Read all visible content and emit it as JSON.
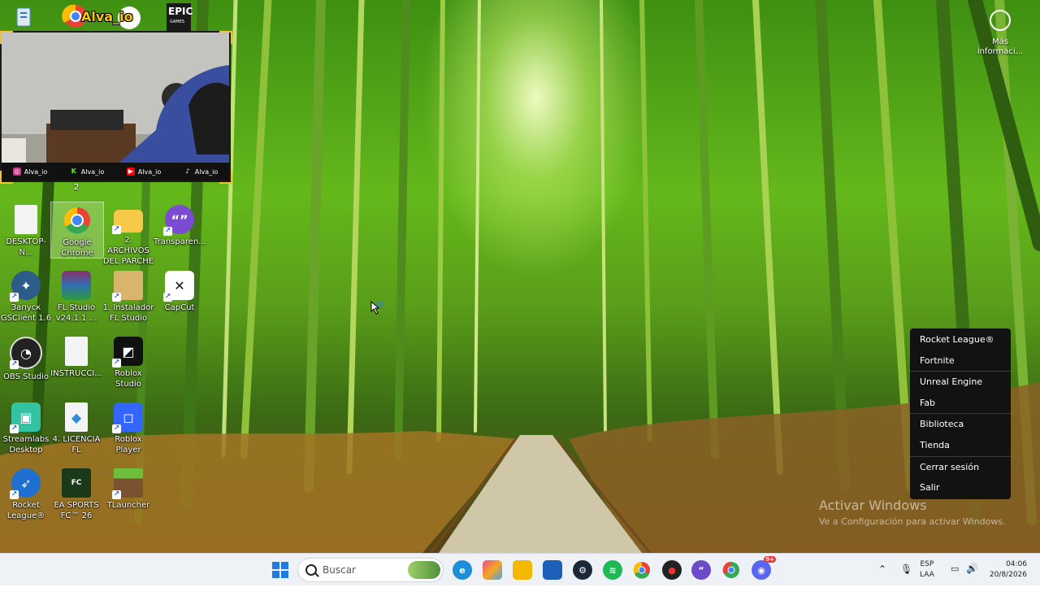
{
  "overlay": {
    "channel_name": "Alva_io",
    "socials": [
      {
        "icon": "instagram-icon",
        "label": "Alva_io",
        "color": "#c13584"
      },
      {
        "icon": "kick-icon",
        "label": "Alva_io",
        "color": "#53fc18"
      },
      {
        "icon": "youtube-icon",
        "label": "Alva_io",
        "color": "#ff0000"
      },
      {
        "icon": "tiktok-icon",
        "label": "Alva_io",
        "color": "#ffffff"
      }
    ],
    "step_number": "2",
    "epic_logo_text": "EPIC",
    "epic_logo_sub": "GAMES"
  },
  "desktop_icons": [
    {
      "name": "desktop-ini",
      "label": "DESKTOP-N...",
      "icon": "document-icon",
      "color": "#f4f4f4"
    },
    {
      "name": "google-chrome",
      "label": "Google Chrome",
      "icon": "chrome-icon",
      "color": "#34a853",
      "selected": true
    },
    {
      "name": "archivos-del-parche",
      "label": "2. ARCHIVOS DEL PARCHE",
      "icon": "folder-icon",
      "color": "#f7c948"
    },
    {
      "name": "transparent",
      "label": "Transparen...",
      "icon": "chat-bubble-icon",
      "color": "#7b4bd1"
    },
    {
      "name": "gsclient",
      "label": "Запуск GSClient 1.6",
      "icon": "counter-strike-icon",
      "color": "#2b5c8a"
    },
    {
      "name": "fl-studio",
      "label": "FL Studio v24.1.1 ...",
      "icon": "winrar-icon",
      "color": "#8e2f6b"
    },
    {
      "name": "instalador-fl",
      "label": "1. Instalador FL Studio",
      "icon": "installer-icon",
      "color": "#d8b56a"
    },
    {
      "name": "capcut",
      "label": "CapCut",
      "icon": "capcut-icon",
      "color": "#ffffff"
    },
    {
      "name": "obs-studio",
      "label": "OBS Studio",
      "icon": "obs-icon",
      "color": "#222222"
    },
    {
      "name": "instrucciones",
      "label": "INSTRUCCI...",
      "icon": "document-icon",
      "color": "#f4f4f4"
    },
    {
      "name": "roblox-studio",
      "label": "Roblox Studio",
      "icon": "roblox-studio-icon",
      "color": "#111111"
    },
    {
      "name": "streamlabs",
      "label": "Streamlabs Desktop",
      "icon": "streamlabs-icon",
      "color": "#31c3a2"
    },
    {
      "name": "licencia-fl",
      "label": "4. LICENCIA FL",
      "icon": "license-icon",
      "color": "#2f8fd6"
    },
    {
      "name": "roblox-player",
      "label": "Roblox Player",
      "icon": "roblox-icon",
      "color": "#3366ff"
    },
    {
      "name": "rocket-league",
      "label": "Rocket League®",
      "icon": "rocket-league-icon",
      "color": "#1f6fd0"
    },
    {
      "name": "ea-fc-26",
      "label": "EA SPORTS FC™ 26",
      "icon": "ea-fc-icon",
      "color": "#1a3a1a"
    },
    {
      "name": "tlauncher",
      "label": "TLauncher",
      "icon": "minecraft-block-icon",
      "color": "#5c8a2e"
    }
  ],
  "more_info": {
    "label": "Más informaci..."
  },
  "tray_menu": {
    "groups": [
      [
        "Rocket League®",
        "Fortnite"
      ],
      [
        "Unreal Engine",
        "Fab"
      ],
      [
        "Biblioteca",
        "Tienda"
      ],
      [
        "Cerrar sesión",
        "Salir"
      ]
    ]
  },
  "watermark": {
    "title": "Activar Windows",
    "subtitle": "Ve a Configuración para activar Windows."
  },
  "taskbar": {
    "search_placeholder": "Buscar",
    "apps": [
      {
        "name": "windows-start",
        "icon": "windows-logo-icon",
        "color": "#1e7be0"
      },
      {
        "name": "widgets",
        "icon": "widgets-landscape-icon",
        "color": "#6aa84f"
      },
      {
        "name": "edge",
        "icon": "edge-icon",
        "color": "#1d8fd8"
      },
      {
        "name": "ms-store",
        "icon": "store-icon",
        "color": "#e44d8e"
      },
      {
        "name": "file-explorer",
        "icon": "folder-icon",
        "color": "#f5b800"
      },
      {
        "name": "app-calculator",
        "icon": "app-icon",
        "color": "#1c5fb8"
      },
      {
        "name": "steam",
        "icon": "steam-icon",
        "color": "#1b2838"
      },
      {
        "name": "spotify",
        "icon": "spotify-icon",
        "color": "#1db954"
      },
      {
        "name": "chrome",
        "icon": "chrome-icon",
        "color": "#ea4335"
      },
      {
        "name": "recorder",
        "icon": "record-icon",
        "color": "#222222"
      },
      {
        "name": "chat-app",
        "icon": "chat-bubble-icon",
        "color": "#6b4bc8"
      },
      {
        "name": "chrome-profile",
        "icon": "chrome-icon",
        "color": "#34a853"
      },
      {
        "name": "discord",
        "icon": "discord-icon",
        "color": "#5865f2",
        "badge": "9+"
      }
    ],
    "tray": {
      "lang_top": "ESP",
      "lang_bottom": "LAA",
      "time": "04:06",
      "date": "20/8/2026"
    }
  }
}
